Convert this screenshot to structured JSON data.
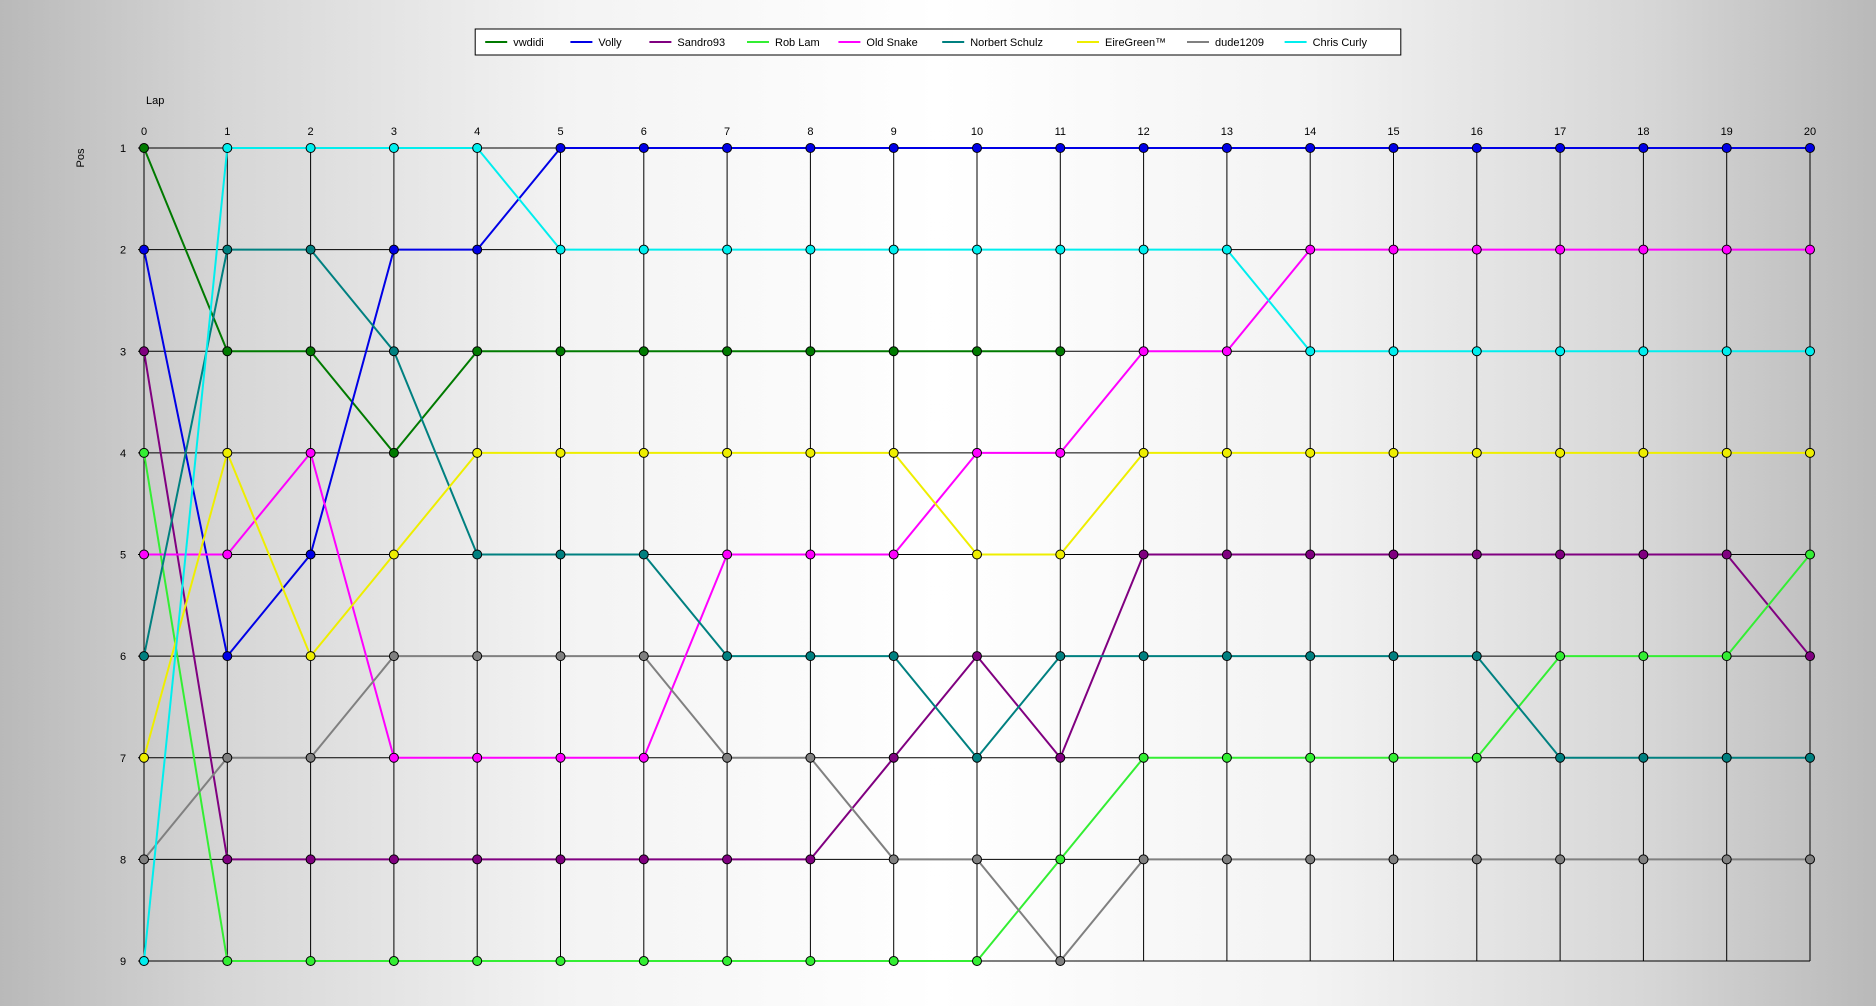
{
  "chart_data": {
    "type": "line",
    "xlabel": "Lap",
    "ylabel": "Pos",
    "x": [
      0,
      1,
      2,
      3,
      4,
      5,
      6,
      7,
      8,
      9,
      10,
      11,
      12,
      13,
      14,
      15,
      16,
      17,
      18,
      19,
      20
    ],
    "xlim": [
      0,
      20
    ],
    "ylim": [
      1,
      9
    ],
    "y_inverted": true,
    "y_ticks": [
      1,
      2,
      3,
      4,
      5,
      6,
      7,
      8,
      9
    ],
    "grid": true,
    "legend_position": "top-center",
    "series": [
      {
        "name": "vwdidi",
        "color": "#007A00",
        "values": [
          1,
          3,
          3,
          4,
          3,
          3,
          3,
          3,
          3,
          3,
          3,
          3,
          null,
          null,
          null,
          null,
          null,
          null,
          null,
          null,
          null
        ]
      },
      {
        "name": "Volly",
        "color": "#0000E6",
        "values": [
          2,
          6,
          5,
          2,
          2,
          1,
          1,
          1,
          1,
          1,
          1,
          1,
          1,
          1,
          1,
          1,
          1,
          1,
          1,
          1,
          1
        ]
      },
      {
        "name": "Sandro93",
        "color": "#800080",
        "values": [
          3,
          8,
          8,
          8,
          8,
          8,
          8,
          8,
          8,
          7,
          6,
          7,
          5,
          5,
          5,
          5,
          5,
          5,
          5,
          5,
          6
        ]
      },
      {
        "name": "Rob Lam",
        "color": "#33EE33",
        "values": [
          4,
          9,
          9,
          9,
          9,
          9,
          9,
          9,
          9,
          9,
          9,
          8,
          7,
          7,
          7,
          7,
          7,
          6,
          6,
          6,
          5
        ]
      },
      {
        "name": "Old Snake",
        "color": "#FF00FF",
        "values": [
          5,
          5,
          4,
          7,
          7,
          7,
          7,
          5,
          5,
          5,
          4,
          4,
          3,
          3,
          2,
          2,
          2,
          2,
          2,
          2,
          2
        ]
      },
      {
        "name": "Norbert Schulz",
        "color": "#008080",
        "values": [
          6,
          2,
          2,
          3,
          5,
          5,
          5,
          6,
          6,
          6,
          7,
          6,
          6,
          6,
          6,
          6,
          6,
          7,
          7,
          7,
          7
        ]
      },
      {
        "name": "EireGreen™",
        "color": "#EEEE00",
        "values": [
          7,
          4,
          6,
          5,
          4,
          4,
          4,
          4,
          4,
          4,
          5,
          5,
          4,
          4,
          4,
          4,
          4,
          4,
          4,
          4,
          4
        ]
      },
      {
        "name": "dude1209",
        "color": "#808080",
        "values": [
          8,
          7,
          7,
          6,
          6,
          6,
          6,
          7,
          7,
          8,
          8,
          9,
          8,
          8,
          8,
          8,
          8,
          8,
          8,
          8,
          8
        ]
      },
      {
        "name": "Chris Curly",
        "color": "#00EEEE",
        "values": [
          9,
          1,
          1,
          1,
          1,
          2,
          2,
          2,
          2,
          2,
          2,
          2,
          2,
          2,
          3,
          3,
          3,
          3,
          3,
          3,
          3
        ]
      }
    ]
  }
}
